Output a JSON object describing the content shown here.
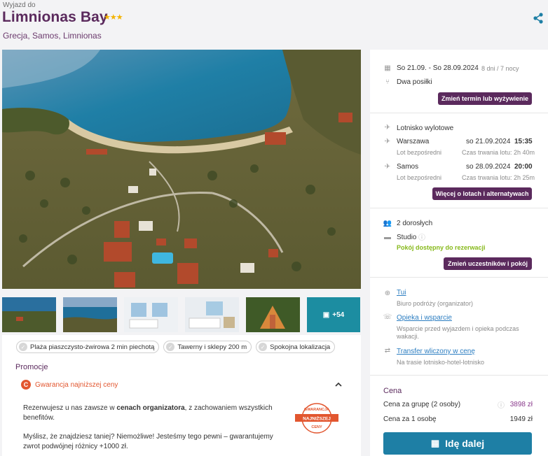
{
  "header": {
    "subtitle": "Wyjazd do",
    "title": "Limnionas Bay",
    "stars": "★★★",
    "location": "Grecja, Samos, Limnionas"
  },
  "gallery": {
    "more_count": "+54"
  },
  "features": [
    "Plaża piaszczysto-żwirowa 2 min piechotą",
    "Tawerny i sklepy 200 m",
    "Spokojna lokalizacja"
  ],
  "promo": {
    "heading": "Promocje",
    "guarantee_label": "Gwarancja najniższej ceny",
    "text1_a": "Rezerwujesz u nas zawsze w ",
    "text1_b": "cenach organizatora",
    "text1_c": ", z zachowaniem wszystkich benefitów.",
    "text2": "Myślisz, że znajdziesz taniej? Niemożliwe! Jesteśmy tego pewni – gwarantujemy zwrot podwójnej różnicy +1000 zł.",
    "badge_top": "GWARANCJA",
    "badge_mid": "NAJNIŻSZEJ",
    "badge_bottom": "CENY"
  },
  "booking": {
    "dates": "So 21.09. - So 28.09.2024",
    "duration": "8 dni / 7 nocy",
    "board": "Dwa posiłki",
    "change_term_btn": "Zmień termin lub wyżywienie",
    "airport_heading": "Lotnisko wylotowe",
    "out_city": "Warszawa",
    "out_date": "so 21.09.2024",
    "out_time": "15:35",
    "out_type": "Lot bezpośredni",
    "out_duration": "Czas trwania lotu: 2h 40m",
    "ret_city": "Samos",
    "ret_date": "so 28.09.2024",
    "ret_time": "20:00",
    "ret_type": "Lot bezpośredni",
    "ret_duration": "Czas trwania lotu: 2h 25m",
    "flights_btn": "Więcej o lotach i alternatywach",
    "guests": "2 dorosłych",
    "room": "Studio",
    "room_status": "Pokój dostępny do rezerwacji",
    "change_guests_btn": "Zmień uczestników i pokój",
    "organizer_link": "Tui",
    "organizer_desc": "Biuro podróży (organizator)",
    "care_link": "Opieka i wsparcie",
    "care_desc": "Wsparcie przed wyjazdem i opieka podczas wakacji.",
    "transfer_link": "Transfer wliczony w cenę",
    "transfer_desc": "Na trasie lotnisko-hotel-lotnisko",
    "price_heading": "Cena",
    "group_label": "Cena za grupę (2 osoby)",
    "group_price": "3898 zł",
    "person_label": "Cena za 1 osobę",
    "person_price": "1949 zł",
    "cta": "Idę dalej"
  }
}
